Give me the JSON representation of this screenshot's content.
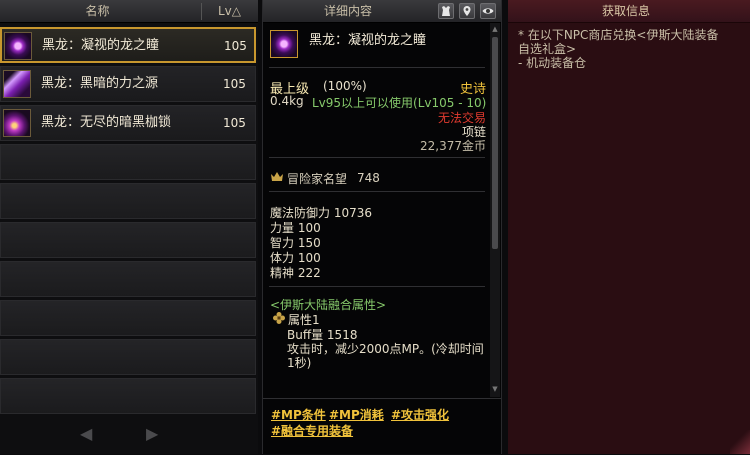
{
  "list": {
    "header_name": "名称",
    "header_lv": "Lv△",
    "items": [
      {
        "name": "黑龙：凝视的龙之瞳",
        "lv": "105"
      },
      {
        "name": "黑龙：黑暗的力之源",
        "lv": "105"
      },
      {
        "name": "黑龙：无尽的暗黑枷锁",
        "lv": "105"
      }
    ],
    "pager": {
      "prev": "◀",
      "next": "▶"
    }
  },
  "detail": {
    "title": "详细内容",
    "name": "黑龙：凝视的龙之瞳",
    "grade": "最上级",
    "grade_pct": "(100%)",
    "rarity": "史诗",
    "weight": "0.4kg",
    "requirement": "Lv95以上可以使用(Lv105 - 10)",
    "trade": "无法交易",
    "type": "项链",
    "price": "22,377金币",
    "reputation_label": "冒险家名望",
    "reputation_value": "748",
    "stats": [
      "魔法防御力 10736",
      "力量 100",
      "智力 150",
      "体力 100",
      "精神 222"
    ],
    "fusion_title": "<伊斯大陆融合属性>",
    "attr_label": "属性1",
    "buff": "Buff量 1518",
    "effect_line1": "攻击时，减少2000点MP。(冷却时间",
    "effect_line2": "1秒)",
    "links": [
      "#MP条件",
      "#MP消耗",
      "#攻击强化",
      "#融合专用装备"
    ]
  },
  "source": {
    "title": "获取信息",
    "line1": "* 在以下NPC商店兑换<伊斯大陆装备",
    "line2": "自选礼盒>",
    "line3": "- 机动装备仓"
  },
  "colors": {
    "selected_border": "#c8972e",
    "rarity": "#f0c23b",
    "requirement": "#86c96b",
    "untradeable": "#e03a2f",
    "source_bg": "#2a0d12"
  },
  "icons": [
    "armor-icon",
    "location-pin-icon",
    "eye-icon",
    "crown-icon",
    "flower-icon"
  ]
}
